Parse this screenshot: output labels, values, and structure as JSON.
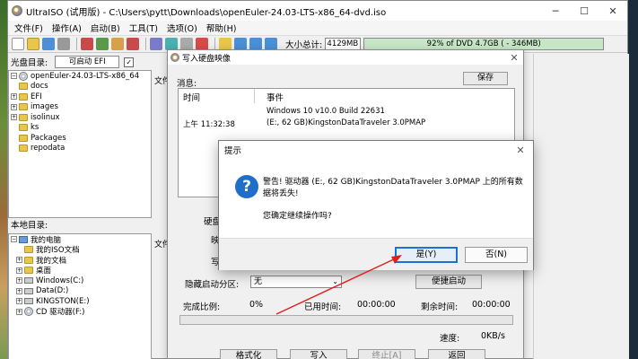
{
  "window": {
    "title": "UltraISO (试用版) - C:\\Users\\pytt\\Downloads\\openEuler-24.03-LTS-x86_64-dvd.iso",
    "controls": [
      "─",
      "☐",
      "✕"
    ]
  },
  "menu": [
    "文件(F)",
    "操作(A)",
    "启动(B)",
    "工具(T)",
    "选项(O)",
    "帮助(H)"
  ],
  "toolbar": {
    "size_label": "大小总计:",
    "size_value": "4129MB",
    "usage_text": "92% of DVD 4.7GB ( - 346MB)"
  },
  "cd_panel": {
    "label": "光盘目录:",
    "boot_label": "可启动 EFI",
    "check": "✓",
    "root": "openEuler-24.03-LTS-x86_64",
    "items": [
      "docs",
      "EFI",
      "images",
      "isolinux",
      "ks",
      "Packages",
      "repodata"
    ]
  },
  "local_panel": {
    "label": "本地目录:",
    "items": [
      {
        "label": "我的电脑",
        "exp": "−",
        "icon": "pc"
      },
      {
        "label": "我的ISO文档",
        "exp": "",
        "icon": "folder"
      },
      {
        "label": "我的文档",
        "exp": "+",
        "icon": "folder"
      },
      {
        "label": "桌面",
        "exp": "+",
        "icon": "folder"
      },
      {
        "label": "Windows(C:)",
        "exp": "+",
        "icon": "drive"
      },
      {
        "label": "Data(D:)",
        "exp": "+",
        "icon": "drive"
      },
      {
        "label": "KINGSTON(E:)",
        "exp": "+",
        "icon": "drive"
      },
      {
        "label": "CD 驱动器(F:)",
        "exp": "+",
        "icon": "cd"
      }
    ]
  },
  "middle": {
    "top_label": "文件",
    "bottom_label": "文件"
  },
  "burn_dialog": {
    "title": "写入硬盘映像",
    "close": "✕",
    "message_label": "消息:",
    "save_label": "保存",
    "col_time": "时间",
    "col_event": "事件",
    "log": [
      {
        "time": "",
        "event": "Windows 10 v10.0 Build 22631"
      },
      {
        "time": "上午 11:32:38",
        "event": "(E:, 62 GB)KingstonDataTraveler 3.0PMAP"
      }
    ],
    "label_disk": "硬盘",
    "label_image": "映",
    "label_write": "写",
    "hidden_partition_label": "隐藏启动分区:",
    "hidden_partition_value": "无",
    "convenient_boot": "便捷启动",
    "completed_label": "完成比例:",
    "completed_value": "0%",
    "elapsed_label": "已用时间:",
    "elapsed_value": "00:00:00",
    "remaining_label": "剩余时间:",
    "remaining_value": "00:00:00",
    "speed_label": "速度:",
    "speed_value": "0KB/s",
    "progress": 0,
    "btn_format": "格式化",
    "btn_write": "写入",
    "btn_abort": "终止[A]",
    "btn_back": "返回"
  },
  "warn_dialog": {
    "title": "提示",
    "close": "✕",
    "icon": "?",
    "message": "警告! 驱动器 (E:, 62 GB)KingstonDataTraveler 3.0PMAP 上的所有数据将丢失!",
    "confirm": "您确定继续操作吗?",
    "yes": "是(Y)",
    "no": "否(N)"
  },
  "colors": {
    "accent": "#1a72d8",
    "arrow": "#e02020",
    "usage_bar": "#c7e6c7"
  }
}
